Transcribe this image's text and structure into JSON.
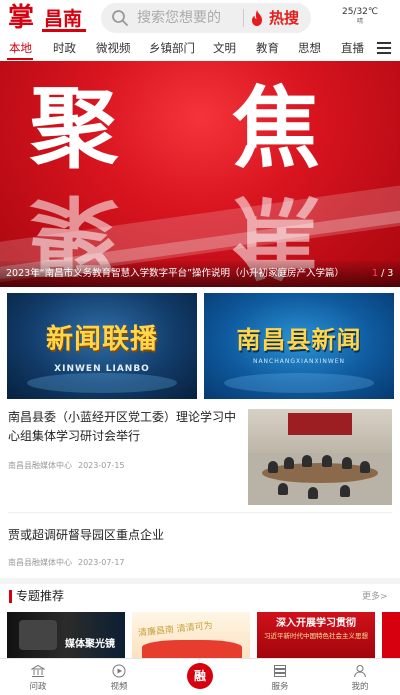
{
  "header": {
    "logo_main": "掌",
    "logo_city": "昌南",
    "search_placeholder": "搜索您想要的",
    "hot_label": "热搜",
    "weather_temp": "25/32℃",
    "weather_cond": "晴"
  },
  "nav": {
    "items": [
      "本地",
      "时政",
      "微视频",
      "乡镇部门",
      "文明",
      "教育",
      "思想",
      "直播"
    ],
    "active_index": 0
  },
  "banner": {
    "headline_left": "聚",
    "headline_right": "焦",
    "caption": "2023年“南昌市义务教育智慧入学数字平台”操作说明（小升初家庭房产入学篇）",
    "page_current": "1",
    "page_total": "/ 3"
  },
  "programs": [
    {
      "title": "新闻联播",
      "subtitle": "XINWEN LIANBO"
    },
    {
      "title": "南昌县新闻",
      "subtitle": "NANCHANGXIANXINWEN"
    }
  ],
  "news": [
    {
      "title": "南昌县委（小蓝经开区党工委）理论学习中心组集体学习研讨会举行",
      "source": "南昌县融媒体中心",
      "date": "2023-07-15"
    },
    {
      "title": "贾或超调研督导园区重点企业",
      "source": "南昌县融媒体中心",
      "date": "2023-07-17"
    }
  ],
  "special": {
    "title": "专题推荐",
    "more": "更多>",
    "cards": [
      {
        "title": "媒体聚光镜"
      },
      {
        "title": "清廉昌南 清清可为"
      },
      {
        "title": "深入开展学习贯彻",
        "subtitle": "习近平新时代中国特色社会主义思想"
      }
    ]
  },
  "tabbar": {
    "items": [
      "问政",
      "视频",
      "融",
      "服务",
      "我的"
    ]
  },
  "colors": {
    "brand_red": "#d7000f",
    "hot_red": "#e61d1d",
    "program_yellow": "#ffd54a"
  },
  "icons": [
    "search-icon",
    "fire-icon",
    "menu-icon",
    "bank-icon",
    "play-icon",
    "grid-icon",
    "user-icon"
  ]
}
